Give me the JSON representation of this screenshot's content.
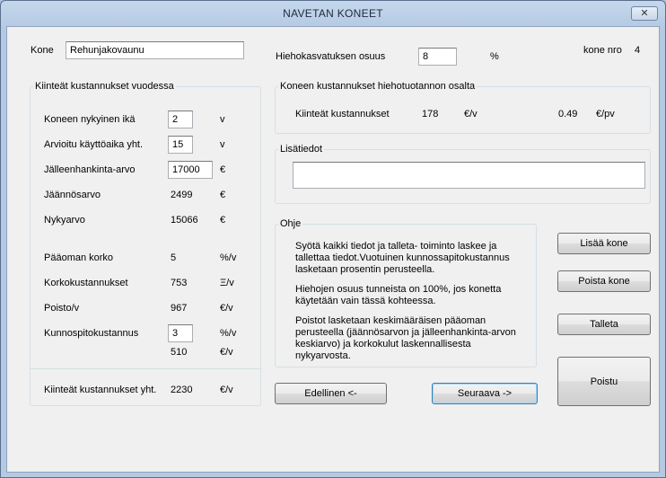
{
  "window": {
    "title": "NAVETAN  KONEET",
    "close_label": "✕"
  },
  "kone": {
    "label": "Kone",
    "value": "Rehunjakovaunu"
  },
  "hieho": {
    "label": "Hiehokasvatuksen osuus",
    "value": "8",
    "unit": "%"
  },
  "kone_nro": {
    "label": "kone nro",
    "value": "4"
  },
  "fixed": {
    "title": "Kiinteät kustannukset vuodessa",
    "age_label": "Koneen nykyinen ikä",
    "age_value": "2",
    "age_unit": "v",
    "life_label": "Arvioitu käyttöaika yht.",
    "life_value": "15",
    "life_unit": "v",
    "replacement_label": "Jälleenhankinta-arvo",
    "replacement_value": "17000",
    "replacement_unit": "€",
    "residual_label": "Jäännösarvo",
    "residual_value": "2499",
    "residual_unit": "€",
    "current_label": "Nykyarvo",
    "current_value": "15066",
    "current_unit": "€",
    "interest_label": "Pääoman korko",
    "interest_value": "5",
    "interest_unit": "%/v",
    "interest_cost_label": "Korkokustannukset",
    "interest_cost_value": "753",
    "interest_cost_unit": "Ξ/v",
    "depreciation_label": "Poisto/v",
    "depreciation_value": "967",
    "depreciation_unit": "€/v",
    "maintenance_label": "Kunnospitokustannus",
    "maintenance_value": "3",
    "maintenance_unit": "%/v",
    "maintenance_cost_value": "510",
    "maintenance_cost_unit": "€/v",
    "total_label": "Kiinteät kustannukset yht.",
    "total_value": "2230",
    "total_unit": "€/v"
  },
  "heifer": {
    "title": "Koneen kustannukset hiehotuotannon osalta",
    "label": "Kiinteät kustannukset",
    "value": "178",
    "unit": "€/v",
    "per_value": "0.49",
    "per_unit": "€/pv"
  },
  "extra": {
    "title": "Lisätiedot",
    "value": ""
  },
  "help": {
    "title": "Ohje",
    "p1": "Syötä kaikki tiedot ja talleta- toiminto laskee ja tallettaa tiedot.Vuotuinen kunnossapitokustannus lasketaan prosentin perusteella.",
    "p2": "Hiehojen osuus tunneista on 100%, jos konetta käytetään vain tässä kohteessa.",
    "p3": "Poistot lasketaan keskimääräisen pääoman perusteella (jäännösarvon ja jälleenhankinta-arvon keskiarvo) ja korkokulut laskennallisesta nykyarvosta."
  },
  "buttons": {
    "add": "Lisää kone",
    "delete": "Poista kone",
    "save": "Talleta",
    "exit": "Poistu",
    "prev": "Edellinen  <-",
    "next": "Seuraava  ->"
  }
}
